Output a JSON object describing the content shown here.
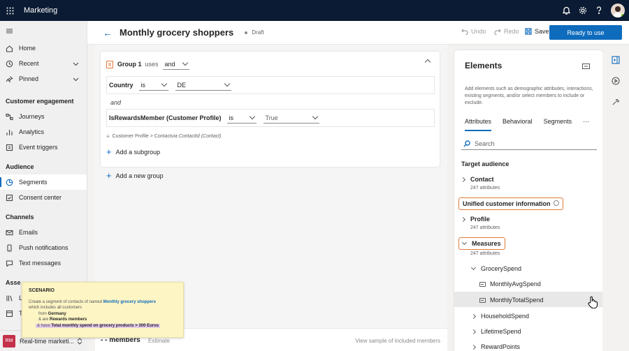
{
  "app": {
    "name": "Marketing"
  },
  "header_icons": [
    "bell-icon",
    "gear-icon",
    "help-icon",
    "avatar"
  ],
  "sidebar": {
    "top_items": [
      {
        "label": "Home",
        "icon": "home-icon"
      },
      {
        "label": "Recent",
        "icon": "clock-icon"
      },
      {
        "label": "Pinned",
        "icon": "pin-icon"
      }
    ],
    "sections": [
      {
        "title": "Customer engagement",
        "items": [
          {
            "label": "Journeys",
            "icon": "journey-icon"
          },
          {
            "label": "Analytics",
            "icon": "chart-icon"
          },
          {
            "label": "Event triggers",
            "icon": "trigger-icon"
          }
        ]
      },
      {
        "title": "Audience",
        "items": [
          {
            "label": "Segments",
            "icon": "segments-icon",
            "active": true
          },
          {
            "label": "Consent center",
            "icon": "consent-icon"
          }
        ]
      },
      {
        "title": "Channels",
        "items": [
          {
            "label": "Emails",
            "icon": "mail-icon"
          },
          {
            "label": "Push notifications",
            "icon": "phone-icon"
          },
          {
            "label": "Text messages",
            "icon": "sms-icon"
          }
        ]
      }
    ],
    "partial_section": "Asse",
    "partial_items": [
      "L",
      "T"
    ],
    "area": {
      "initials": "RM",
      "label": "Real-time marketi..."
    }
  },
  "commandbar": {
    "title": "Monthly grocery shoppers",
    "status": "Draft",
    "undo": "Undo",
    "redo": "Redo",
    "save": "Save",
    "ready": "Ready to use"
  },
  "builder": {
    "group_label": "Group 1",
    "uses": "uses",
    "operator": "and",
    "condition1": {
      "attribute": "Country",
      "operator": "is",
      "value": "DE"
    },
    "and_text": "and",
    "condition2": {
      "attribute": "IsRewardsMember (Customer Profile)",
      "operator": "is",
      "value": "True"
    },
    "path": {
      "prefix": "Customer Profile > Contact ",
      "via": "via ContactId (Contact)"
    },
    "add_subgroup": "Add a subgroup",
    "add_group": "Add a new group"
  },
  "footer": {
    "members": "- - members",
    "estimate": "Estimate",
    "view_sample": "View sample of included members"
  },
  "scenario": {
    "title": "SCENARIO",
    "line1_prefix": "Create a segment of contacts of named ",
    "line1_name": "Monthly grocery shoppers",
    "line2": "which includes all customers",
    "from_label": "from",
    "from_value": "Germany",
    "are_label": "&  are",
    "are_value": "Rewards members",
    "have_label": "&  have",
    "have_value": "Total monthly spend on grocery products > 300 Euros"
  },
  "elements": {
    "title": "Elements",
    "description": "Add elements such as demographic attributes, interactions, existing segments, and/or select members to include or exclude.",
    "tabs": [
      "Attributes",
      "Behavioral",
      "Segments",
      "···"
    ],
    "search_placeholder": "Search",
    "target_audience": "Target audience",
    "contact": {
      "label": "Contact",
      "count": "247 attributes"
    },
    "unified": "Unified customer information",
    "profile": {
      "label": "Profile",
      "count": "247 attributes"
    },
    "measures": {
      "label": "Measures",
      "count": "247 attributes"
    },
    "grocery": "GrocerySpend",
    "monthly_avg": "MonthlyAvgSpend",
    "monthly_total": "MonthlyTotalSpend",
    "household": "HouseholdSpend",
    "lifetime": "LifetimeSpend",
    "reward": "RewardPoints"
  },
  "colors": {
    "accent": "#0f6cbd",
    "highlight": "#e07b39",
    "header": "#0b1b33",
    "scenario_bg": "#fdf5c4"
  }
}
